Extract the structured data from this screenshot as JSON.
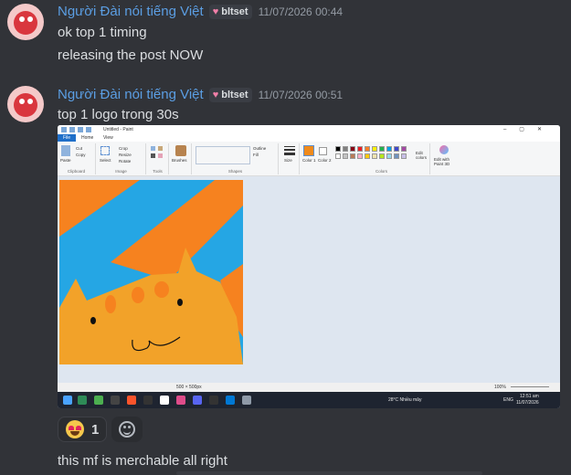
{
  "messages": [
    {
      "username": "Người Đài nói tiếng Việt",
      "tag": "bltset",
      "timestamp": "11/07/2026 00:44",
      "lines": [
        "ok top 1 timing",
        "releasing the post NOW"
      ]
    },
    {
      "username": "Người Đài nói tiếng Việt",
      "tag": "bltset",
      "timestamp": "11/07/2026 00:51",
      "lines": [
        "top 1 logo trong 30s"
      ]
    }
  ],
  "screenshot": {
    "window_title": "Untitled - Paint",
    "menu": {
      "file": "File",
      "home": "Home",
      "view": "View"
    },
    "ribbon": {
      "clipboard": "Clipboard",
      "paste": "Paste",
      "cut": "Cut",
      "copy": "Copy",
      "image": "Image",
      "select": "Select",
      "crop": "Crop",
      "resize": "Resize",
      "rotate": "Rotate",
      "tools": "Tools",
      "brushes": "Brushes",
      "shapes": "Shapes",
      "outline": "Outline",
      "fill": "Fill",
      "size": "Size",
      "color1": "Color 1",
      "color2": "Color 2",
      "colors": "Colors",
      "edit_colors": "Edit colors",
      "edit_paint3d": "Edit with Paint 3D"
    },
    "status": {
      "dimensions": "500 × 500px",
      "zoom": "100%"
    },
    "taskbar": {
      "weather": "28°C Nhiều mây",
      "lang": "ENG",
      "time": "12:51 am",
      "date": "11/07/2026"
    }
  },
  "palette": [
    "#000000",
    "#7f7f7f",
    "#880015",
    "#ed1c24",
    "#ff7f27",
    "#fff200",
    "#22b14c",
    "#00a2e8",
    "#3f48cc",
    "#a349a4",
    "#ffffff",
    "#c3c3c3",
    "#b97a57",
    "#ffaec9",
    "#ffc90e",
    "#efe4b0",
    "#b5e61d",
    "#99d9ea",
    "#7092be",
    "#c8bfe7"
  ],
  "reactions": [
    {
      "emoji": "star-struck-emoji",
      "count": "1"
    }
  ],
  "last_message": "this mf is merchable all right"
}
